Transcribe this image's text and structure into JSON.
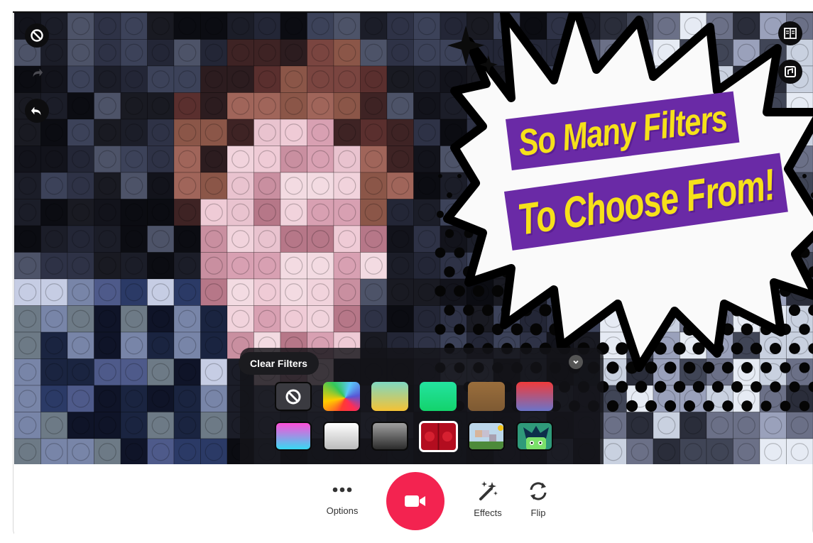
{
  "side_controls": {
    "disable_icon": "disable-icon",
    "redo_icon": "redo-icon",
    "undo_icon": "undo-icon",
    "layout_icon": "layout-icon",
    "music_icon": "music-note-icon"
  },
  "banner": {
    "line1": "So Many Filters",
    "line2": "To Choose From!"
  },
  "filters": {
    "clear_label": "Clear Filters",
    "collapse_icon": "chevron-down-icon",
    "swatches": [
      {
        "id": "none"
      },
      {
        "id": "rainbow"
      },
      {
        "id": "teal-orange"
      },
      {
        "id": "green"
      },
      {
        "id": "sepia"
      },
      {
        "id": "red-blue"
      },
      {
        "id": "pink-cyan"
      },
      {
        "id": "white-grey"
      },
      {
        "id": "grey-black"
      },
      {
        "id": "red-dots",
        "selected": true
      },
      {
        "id": "pixel-scene"
      },
      {
        "id": "cartoon-face"
      }
    ]
  },
  "toolbar": {
    "options_label": "Options",
    "effects_label": "Effects",
    "flip_label": "Flip",
    "record_icon": "video-camera-icon"
  },
  "colors": {
    "record": "#f32350",
    "banner_bg": "#6a2aa6",
    "banner_text": "#f6e11a"
  }
}
